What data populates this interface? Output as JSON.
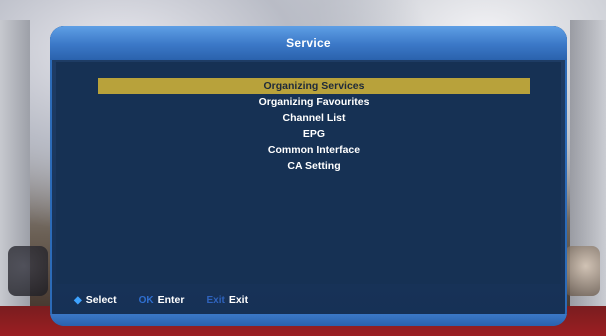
{
  "header": {
    "title": "Service"
  },
  "menu": {
    "items": [
      {
        "label": "Organizing Services",
        "selected": true
      },
      {
        "label": "Organizing Favourites",
        "selected": false
      },
      {
        "label": "Channel List",
        "selected": false
      },
      {
        "label": "EPG",
        "selected": false
      },
      {
        "label": "Common Interface",
        "selected": false
      },
      {
        "label": "CA Setting",
        "selected": false
      }
    ]
  },
  "footer": {
    "select": {
      "key_icon": "updown-arrow-icon",
      "label": "Select"
    },
    "ok": {
      "key": "OK",
      "label": "Enter"
    },
    "exit": {
      "key": "Exit",
      "label": "Exit"
    }
  },
  "colors": {
    "panel": "#163154",
    "title_bar": "#3b78c7",
    "highlight": "#b8a23b"
  }
}
